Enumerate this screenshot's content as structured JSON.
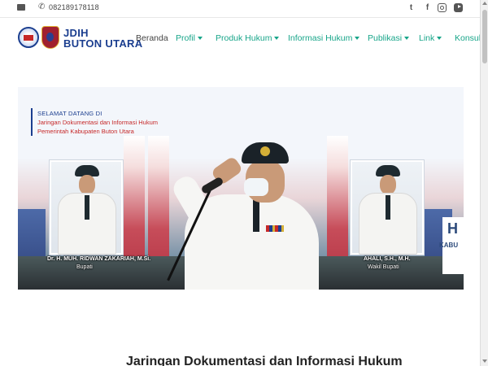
{
  "topbar": {
    "phone_number": "082189178118",
    "icons": [
      "mail-icon",
      "phone-icon",
      "twitter-icon",
      "facebook-icon",
      "instagram-icon",
      "youtube-icon"
    ]
  },
  "navbar": {
    "brand_line1": "JDIH",
    "brand_line2": "BUTON UTARA",
    "items": [
      {
        "label": "Beranda"
      },
      {
        "label": "Profil"
      },
      {
        "label": "Produk Hukum"
      },
      {
        "label": "Informasi Hukum"
      },
      {
        "label": "Publikasi"
      },
      {
        "label": "Link"
      },
      {
        "label": "Konsult"
      }
    ]
  },
  "banner": {
    "welcome_line1": "SELAMAT DATANG DI",
    "welcome_line2": "Jaringan Dokumentasi dan Informasi Hukum",
    "welcome_line3": "Pemerintah Kabupaten Buton Utara",
    "left_official": {
      "name": "Dr. H. MUH. RIDWAN ZAKARIAH, M.Si.",
      "role": "Bupati"
    },
    "right_official": {
      "name": "AHALI, S.H., M.H.",
      "role": "Wakil Bupati"
    },
    "sign_letter": "H",
    "sign_text": "KABU"
  },
  "section": {
    "heading": "Jaringan Dokumentasi dan Informasi Hukum"
  },
  "colors": {
    "accent": "#17a589",
    "brand": "#1b3e8f",
    "red": "#c62828"
  }
}
